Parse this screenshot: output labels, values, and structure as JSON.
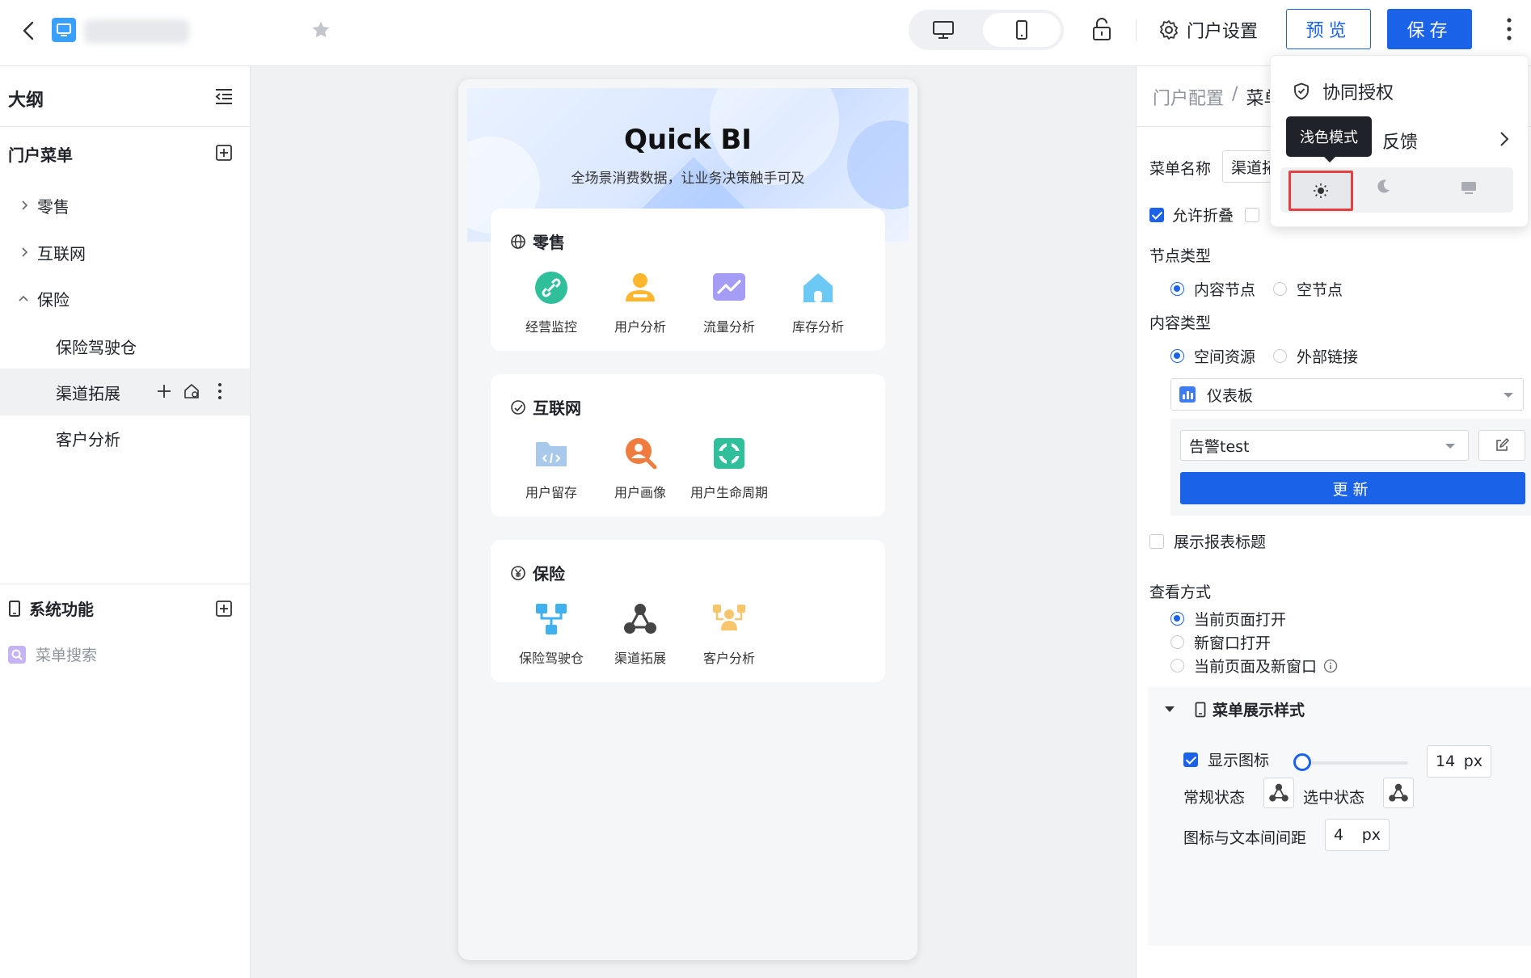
{
  "toolbar": {
    "portal_settings_label": "门户设置",
    "preview_label": "预览",
    "save_label": "保存"
  },
  "sidebar": {
    "outline_title": "大纲",
    "portal_menu_label": "门户菜单",
    "tree": [
      {
        "label": "零售"
      },
      {
        "label": "互联网"
      },
      {
        "label": "保险"
      },
      {
        "label": "保险驾驶仓"
      },
      {
        "label": "渠道拓展"
      },
      {
        "label": "客户分析"
      }
    ],
    "system_functions_label": "系统功能",
    "menu_search_label": "菜单搜索"
  },
  "preview": {
    "brand": "Quick BI",
    "subtitle": "全场景消费数据，让业务决策触手可及",
    "sections": [
      {
        "title": "零售",
        "items": [
          "经营监控",
          "用户分析",
          "流量分析",
          "库存分析"
        ]
      },
      {
        "title": "互联网",
        "items": [
          "用户留存",
          "用户画像",
          "用户生命周期"
        ]
      },
      {
        "title": "保险",
        "items": [
          "保险驾驶仓",
          "渠道拓展",
          "客户分析"
        ]
      }
    ]
  },
  "panel": {
    "breadcrumb_root": "门户配置",
    "breadcrumb_sep": "/",
    "breadcrumb_current": "菜单",
    "menu_name_label": "菜单名称",
    "menu_name_value": "渠道拓",
    "allow_collapse_label": "允许折叠",
    "node_type_label": "节点类型",
    "node_type_content": "内容节点",
    "node_type_empty": "空节点",
    "content_type_label": "内容类型",
    "content_type_space": "空间资源",
    "content_type_external": "外部链接",
    "resource_type": "仪表板",
    "resource_name": "告警test",
    "update_label": "更新",
    "show_report_title_label": "展示报表标题",
    "view_mode_label": "查看方式",
    "view_mode_options": [
      "当前页面打开",
      "新窗口打开",
      "当前页面及新窗口"
    ],
    "style_section_title": "菜单展示样式",
    "show_icon_label": "显示图标",
    "icon_size_value": "14",
    "unit_px": "px",
    "normal_state_label": "常规状态",
    "selected_state_label": "选中状态",
    "icon_text_gap_label": "图标与文本间间距",
    "icon_text_gap_value": "4"
  },
  "dropdown_menu": {
    "collab_auth_label": "协同授权",
    "feedback_label_visible": "反馈",
    "tooltip_label": "浅色模式"
  },
  "state": {
    "icon_size_slider_fraction": 0.0,
    "allow_collapse_checked": true,
    "show_icon_checked": true,
    "show_report_title_checked": false,
    "selected_node_type": "内容节点",
    "selected_content_type": "空间资源",
    "selected_view_mode": "当前页面打开",
    "selected_theme": "浅色模式"
  },
  "colors": {
    "primary": "#1a63e8",
    "highlight_border": "#e5403f",
    "tooltip_bg": "#1f2329"
  }
}
